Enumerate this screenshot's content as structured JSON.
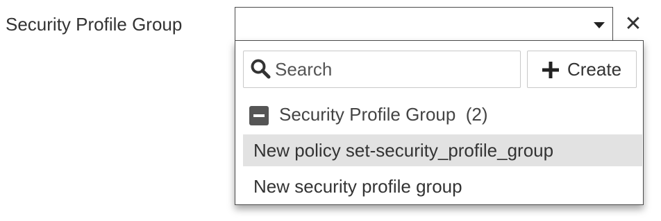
{
  "field": {
    "label": "Security Profile Group",
    "selected_value": ""
  },
  "dropdown": {
    "search": {
      "placeholder": "Search",
      "value": ""
    },
    "create_button": {
      "label": "Create",
      "icon": "plus-icon"
    },
    "group": {
      "label": "Security Profile Group  (2)",
      "icon": "collapse-icon",
      "expanded": true,
      "options": [
        {
          "label": "New policy set-security_profile_group",
          "highlighted": true
        },
        {
          "label": "New security profile group",
          "highlighted": false
        }
      ]
    }
  },
  "icons": {
    "caret": "chevron-down-icon",
    "clear": "close-icon",
    "search": "search-icon"
  },
  "colors": {
    "text": "#333333",
    "border": "#4a4a4a",
    "highlight": "#e2e2e2",
    "collapse_icon": "#555555"
  }
}
